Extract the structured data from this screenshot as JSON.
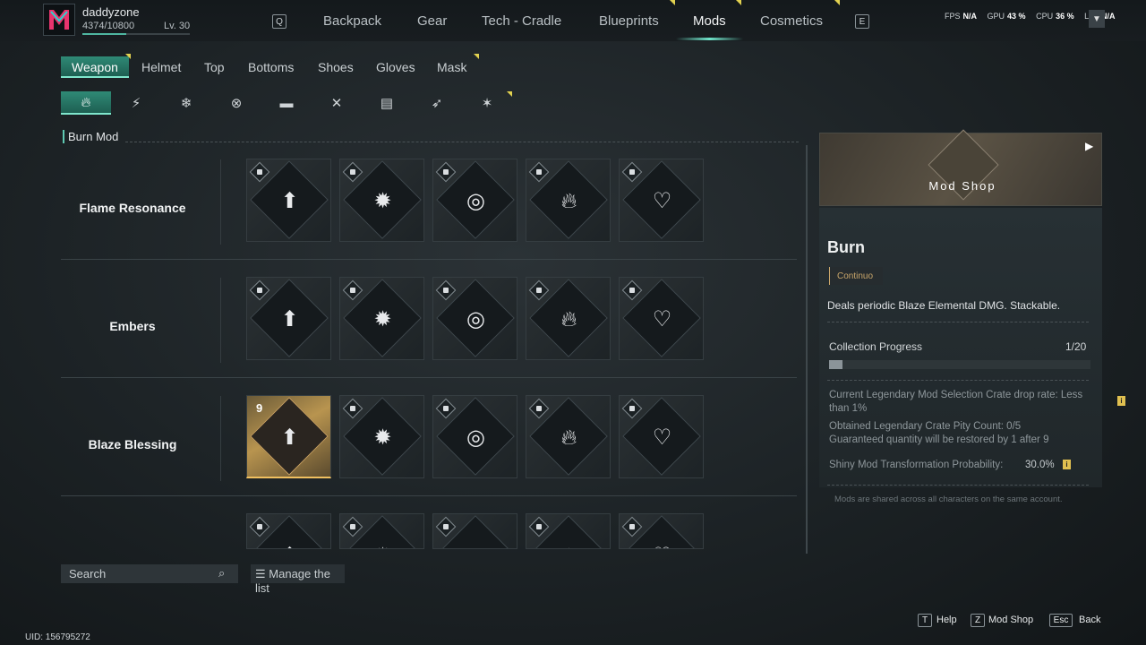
{
  "player": {
    "name": "daddyzone",
    "xp": "4374/10800",
    "level": "Lv. 30",
    "xp_fraction": 0.405
  },
  "nav": {
    "key_left": "Q",
    "key_right": "E",
    "tabs": [
      "Backpack",
      "Gear",
      "Tech - Cradle",
      "Blueprints",
      "Mods",
      "Cosmetics"
    ],
    "active": "Mods"
  },
  "stats": {
    "fps_label": "FPS",
    "fps": "N/A",
    "gpu_label": "GPU",
    "gpu": "43 %",
    "cpu_label": "CPU",
    "cpu": "36 %",
    "lat_label": "LAT",
    "lat": "N/A"
  },
  "categories": [
    "Weapon",
    "Helmet",
    "Top",
    "Bottoms",
    "Shoes",
    "Gloves",
    "Mask"
  ],
  "active_category": "Weapon",
  "elements": [
    "fire-icon",
    "lightning-icon",
    "snowflake-icon",
    "crossed-circle-icon",
    "anvil-icon",
    "crossed-tools-icon",
    "bandage-icon",
    "crossbow-icon",
    "hammer-spark-icon"
  ],
  "section_title": "Burn Mod",
  "rows": [
    {
      "label": "Flame Resonance",
      "cards": [
        {
          "icon": "burst-arrow-icon",
          "locked": true
        },
        {
          "icon": "explosion-icon",
          "locked": true
        },
        {
          "icon": "vortex-icon",
          "locked": true
        },
        {
          "icon": "flame-icon",
          "locked": true
        },
        {
          "icon": "heart-pulse-icon",
          "locked": true
        }
      ]
    },
    {
      "label": "Embers",
      "cards": [
        {
          "icon": "burst-arrow-icon",
          "locked": true
        },
        {
          "icon": "explosion-icon",
          "locked": true
        },
        {
          "icon": "vortex-icon",
          "locked": true
        },
        {
          "icon": "flame-icon",
          "locked": true
        },
        {
          "icon": "heart-pulse-icon",
          "locked": true
        }
      ]
    },
    {
      "label": "Blaze Blessing",
      "cards": [
        {
          "icon": "burst-arrow-icon",
          "locked": false,
          "count": "9"
        },
        {
          "icon": "explosion-icon",
          "locked": true
        },
        {
          "icon": "vortex-icon",
          "locked": true
        },
        {
          "icon": "flame-icon",
          "locked": true
        },
        {
          "icon": "heart-pulse-icon",
          "locked": true
        }
      ]
    }
  ],
  "search": {
    "placeholder": "Search",
    "manage_label": "Manage the list"
  },
  "shop": {
    "name": "Mod Shop"
  },
  "detail": {
    "title": "Burn",
    "tag": "Continuo",
    "description": "Deals periodic Blaze Elemental DMG. Stackable.",
    "progress_label": "Collection Progress",
    "progress_value": "1/20",
    "progress_fraction": 0.05,
    "drop_rate": "Current Legendary Mod Selection Crate drop rate: Less than 1%",
    "pity_line1": "Obtained Legendary Crate Pity Count: 0/5",
    "pity_line2": "Guaranteed quantity will be restored by 1 after 9",
    "shiny": "Shiny Mod Transformation Probability:",
    "shiny_value": "30.0%",
    "footnote": "Mods are shared across all characters on the same account."
  },
  "hotkeys": [
    {
      "key": "T",
      "label": "Help"
    },
    {
      "key": "Z",
      "label": "Mod Shop"
    },
    {
      "key": "Esc",
      "label": "Back"
    }
  ],
  "uid": "UID: 156795272",
  "colors": {
    "accent": "#2f8a76",
    "accent_light": "#7fe6cc",
    "gold": "#b8944f",
    "notify": "#e2d250"
  }
}
